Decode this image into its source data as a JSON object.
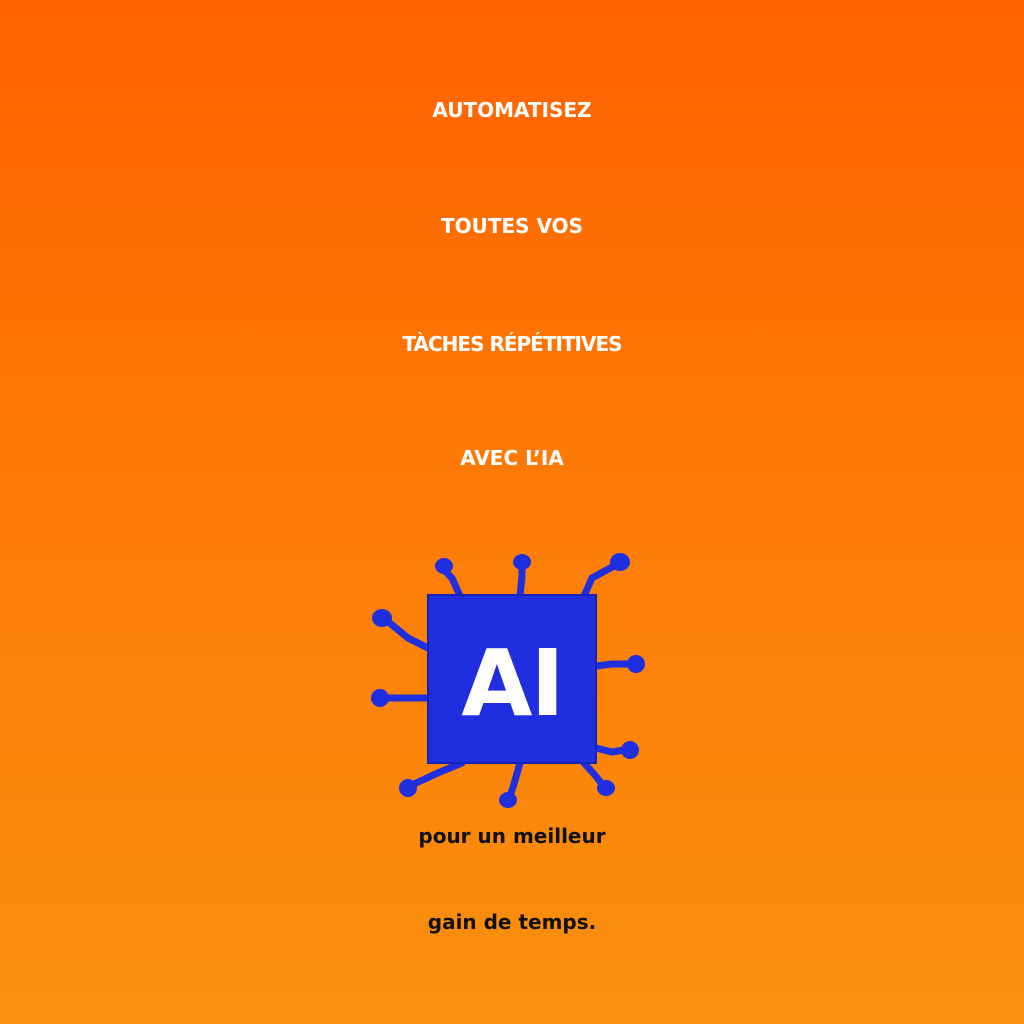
{
  "headline": {
    "line1": "AUTOMATISEZ",
    "line2": "TOUTES VOS",
    "line3": "TÀCHES RÉPÉTITIVES",
    "line4": "AVEC L’IA"
  },
  "chip": {
    "label": "AI",
    "icon": "ai-chip-icon",
    "color": "#1f2fe0"
  },
  "subline": {
    "line1": "pour un meilleur",
    "line2": "gain de temps."
  },
  "colors": {
    "background_top": "#fe6200",
    "background_bottom": "#f8900e",
    "headline": "#ffffff",
    "subline": "#111111"
  }
}
